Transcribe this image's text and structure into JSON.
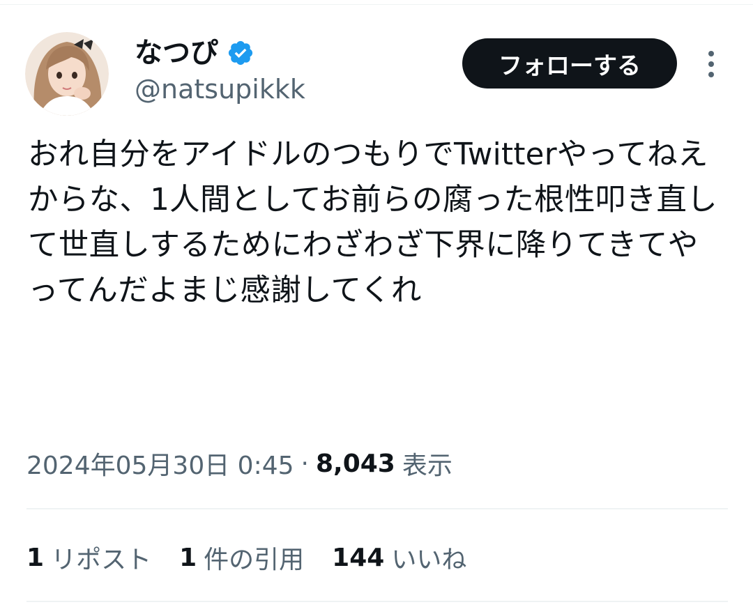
{
  "author": {
    "display_name": "なつぴ",
    "handle": "@natsupikkk",
    "verified": true,
    "verified_color": "#1d9bf0"
  },
  "follow_button": {
    "label": "フォローする",
    "bg_color": "#0f1419",
    "text_color": "#ffffff"
  },
  "menu": {
    "icon": "more-vertical-icon"
  },
  "tweet": {
    "text": "おれ自分をアイドルのつもりでTwitterやってねえからな、1人間としてお前らの腐った根性叩き直して世直しするためにわざわざ下界に降りてきてやってんだよまじ感謝してくれ"
  },
  "meta": {
    "timestamp": "2024年05月30日 0:45",
    "separator": "·",
    "views_count": "8,043",
    "views_label": "表示"
  },
  "stats": {
    "reposts_count": "1",
    "reposts_label": "リポスト",
    "quotes_count": "1",
    "quotes_label": "件の引用",
    "likes_count": "144",
    "likes_label": "いいね"
  },
  "colors": {
    "primary_text": "#0f1419",
    "secondary_text": "#536471",
    "divider": "#eff3f4"
  }
}
